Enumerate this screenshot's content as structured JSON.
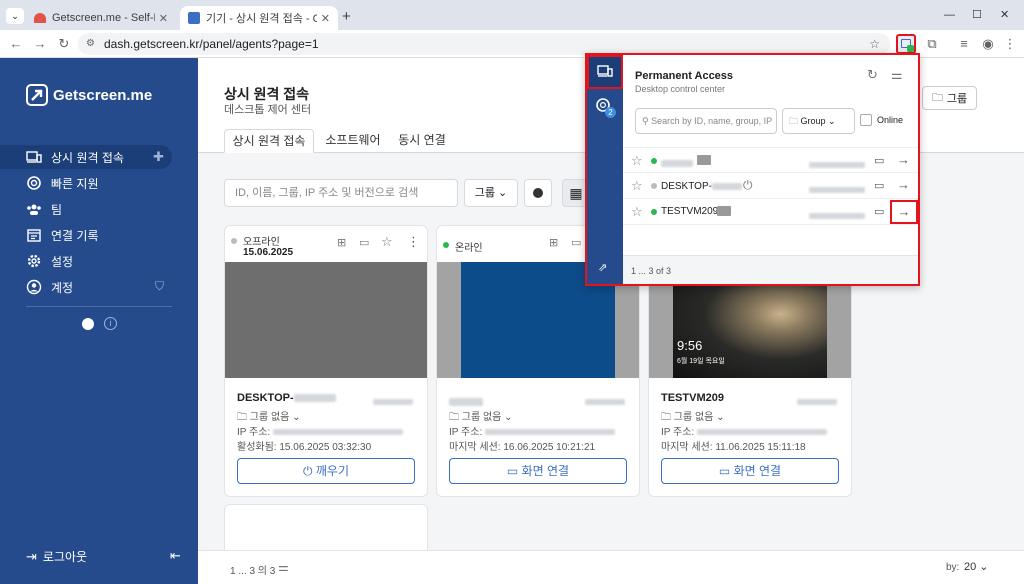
{
  "browser": {
    "tabs": [
      {
        "title": "Getscreen.me - Self-Hosted - I"
      },
      {
        "title": "기기 - 상시 원격 접속 - Getscre"
      }
    ],
    "new_tab": "+",
    "url": "dash.getscreen.kr/panel/agents?page=1"
  },
  "sidebar": {
    "brand": "Getscreen.me",
    "items": [
      {
        "label": "상시 원격 접속",
        "icon": "devices-icon"
      },
      {
        "label": "빠른 지원",
        "icon": "lifebuoy-icon"
      },
      {
        "label": "팀",
        "icon": "team-icon"
      },
      {
        "label": "연결 기록",
        "icon": "history-icon"
      },
      {
        "label": "설정",
        "icon": "gear-icon"
      },
      {
        "label": "계정",
        "icon": "account-icon"
      }
    ],
    "logout": "로그아웃"
  },
  "main": {
    "title": "상시 원격 접속",
    "subtitle": "데스크톱 제어 센터",
    "group_button": "그룹",
    "tabs": [
      "상시 원격 접속",
      "소프트웨어",
      "동시 연결"
    ],
    "search_placeholder": "ID, 이름, 그룹, IP 주소 및 버전으로 검색",
    "group_select": "그룹",
    "pagination": "1 ... 3 의 3",
    "per_page_label": "by:",
    "per_page_value": "20"
  },
  "cards": [
    {
      "status": "오프라인",
      "status_color": "#bbbbbb",
      "date": "15.06.2025",
      "name": "DESKTOP-",
      "group": "그룹 없음",
      "ip_label": "IP 주소:",
      "time_label": "활성화됨:",
      "time": "15.06.2025 03:32:30",
      "action": "깨우기",
      "action_icon": "power-icon"
    },
    {
      "status": "온라인",
      "status_color": "#2db84d",
      "date": "",
      "name": "",
      "group": "그룹 없음",
      "ip_label": "IP 주소:",
      "time_label": "마지막 세션:",
      "time": "16.06.2025 10:21:21",
      "action": "화면 연결",
      "action_icon": "screen-connect-icon"
    },
    {
      "status": "",
      "status_color": "",
      "date": "",
      "name": "TESTVM209",
      "group": "그룹 없음",
      "ip_label": "IP 주소:",
      "time_label": "마지막 세션:",
      "time": "11.06.2025 15:11:18",
      "action": "화면 연결",
      "action_icon": "screen-connect-icon",
      "lock_time": "9:56",
      "lock_date": "6월 19일 목요일"
    }
  ],
  "popup": {
    "title": "Permanent Access",
    "subtitle": "Desktop control center",
    "badge": "2",
    "search_placeholder": "Search by ID, name, group, IP",
    "group_select": "Group",
    "online_label": "Online",
    "rows": [
      {
        "name": "",
        "status_color": "#2db84d"
      },
      {
        "name": "DESKTOP-",
        "status_color": "#bbbbbb"
      },
      {
        "name": "TESTVM209",
        "status_color": "#2db84d"
      }
    ],
    "pagination": "1 ... 3 of 3"
  },
  "colors": {
    "brand": "#254b8c",
    "accent": "#3a6fc4",
    "highlight": "#e5131c"
  }
}
